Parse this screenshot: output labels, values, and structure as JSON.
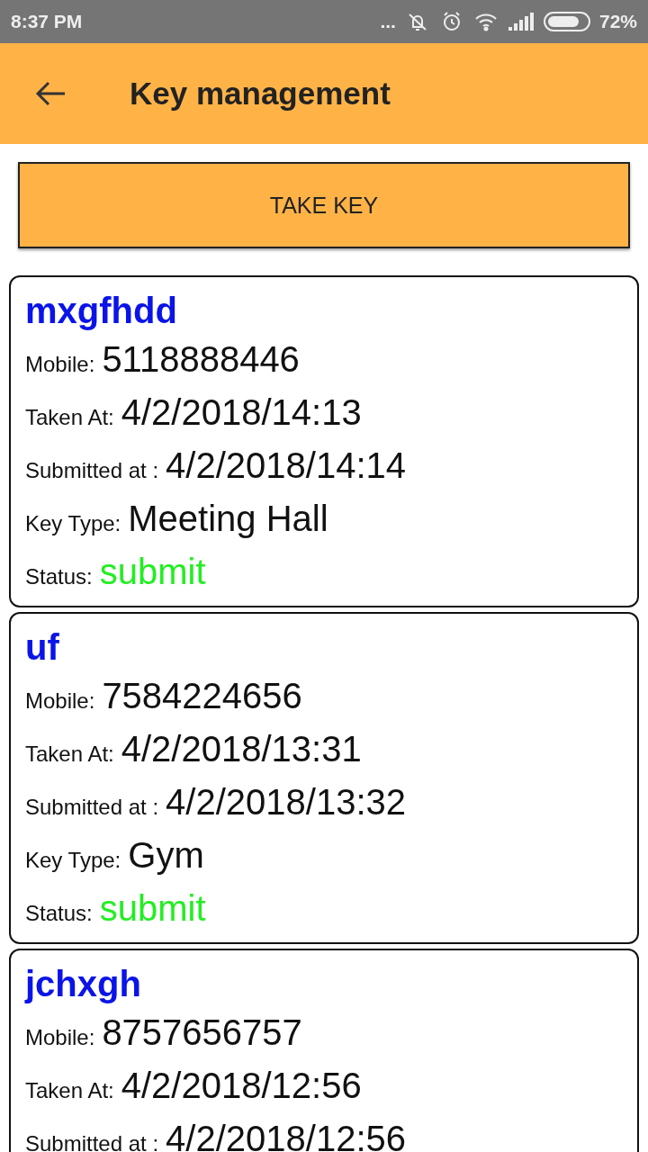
{
  "status_bar": {
    "time": "8:37 PM",
    "overflow": "...",
    "battery": "72%"
  },
  "app_bar": {
    "title": "Key management"
  },
  "take_key_button": "TAKE KEY",
  "records": [
    {
      "name": "mxgfhdd",
      "fields": [
        {
          "kind": "text",
          "label": "Mobile:",
          "value": "5118888446"
        },
        {
          "kind": "text",
          "label": "Taken At:",
          "value": "4/2/2018/14:13"
        },
        {
          "kind": "text",
          "label": "Submitted at :",
          "value": "4/2/2018/14:14"
        },
        {
          "kind": "text",
          "label": "Key Type:",
          "value": "Meeting Hall"
        },
        {
          "kind": "status",
          "label": "Status:",
          "value": "submit"
        }
      ]
    },
    {
      "name": "uf",
      "fields": [
        {
          "kind": "text",
          "label": "Mobile:",
          "value": "7584224656"
        },
        {
          "kind": "text",
          "label": "Taken At:",
          "value": "4/2/2018/13:31"
        },
        {
          "kind": "text",
          "label": "Submitted at :",
          "value": "4/2/2018/13:32"
        },
        {
          "kind": "text",
          "label": "Key Type:",
          "value": "Gym"
        },
        {
          "kind": "status",
          "label": "Status:",
          "value": "submit"
        }
      ]
    },
    {
      "name": "jchxgh",
      "fields": [
        {
          "kind": "text",
          "label": "Mobile:",
          "value": "8757656757"
        },
        {
          "kind": "text",
          "label": "Taken At:",
          "value": "4/2/2018/12:56"
        },
        {
          "kind": "text",
          "label": "Submitted at :",
          "value": "4/2/2018/12:56"
        }
      ]
    }
  ]
}
